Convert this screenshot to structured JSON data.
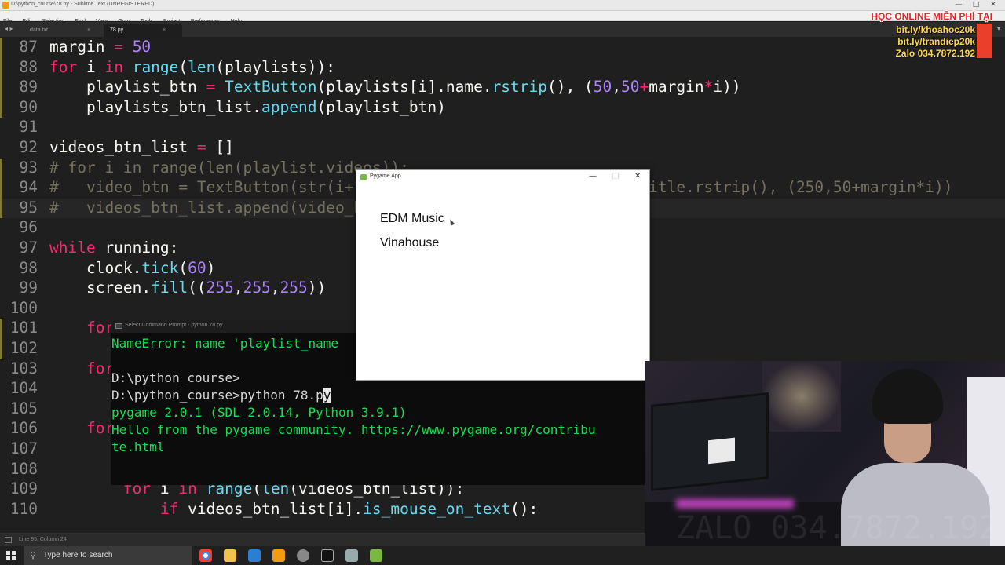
{
  "window": {
    "title": "D:\\python_course\\78.py - Sublime Text (UNREGISTERED)",
    "controls": [
      "—",
      "□",
      "✕"
    ]
  },
  "menu": [
    "File",
    "Edit",
    "Selection",
    "Find",
    "View",
    "Goto",
    "Tools",
    "Project",
    "Preferences",
    "Help"
  ],
  "tabs": [
    {
      "label": "data.txt",
      "close": "×"
    },
    {
      "label": "78.py",
      "close": "×"
    }
  ],
  "tabbar": {
    "nav": "◂ ▸",
    "dropdown": "▾"
  },
  "editor": {
    "lines": [
      {
        "n": "87",
        "tokens": [
          [
            "fg",
            "margin "
          ],
          [
            "op",
            "="
          ],
          [
            "fg",
            " "
          ],
          [
            "num",
            "50"
          ]
        ]
      },
      {
        "n": "88",
        "tokens": [
          [
            "kw",
            "for"
          ],
          [
            "fg",
            " i "
          ],
          [
            "kw",
            "in"
          ],
          [
            "fg",
            " "
          ],
          [
            "fn",
            "range"
          ],
          [
            "fg",
            "("
          ],
          [
            "fn",
            "len"
          ],
          [
            "fg",
            "(playlists)):"
          ]
        ]
      },
      {
        "n": "89",
        "tokens": [
          [
            "fg",
            "    playlist_btn "
          ],
          [
            "op",
            "="
          ],
          [
            "fg",
            " "
          ],
          [
            "fn",
            "TextButton"
          ],
          [
            "fg",
            "(playlists[i].name."
          ],
          [
            "fn",
            "rstrip"
          ],
          [
            "fg",
            "(), ("
          ],
          [
            "num",
            "50"
          ],
          [
            "fg",
            ","
          ],
          [
            "num",
            "50"
          ],
          [
            "op",
            "+"
          ],
          [
            "fg",
            "margin"
          ],
          [
            "op",
            "*"
          ],
          [
            "fg",
            "i))"
          ]
        ]
      },
      {
        "n": "90",
        "tokens": [
          [
            "fg",
            "    playlists_btn_list."
          ],
          [
            "fn",
            "append"
          ],
          [
            "fg",
            "(playlist_btn)"
          ]
        ]
      },
      {
        "n": "91",
        "tokens": []
      },
      {
        "n": "92",
        "tokens": [
          [
            "fg",
            "videos_btn_list "
          ],
          [
            "op",
            "="
          ],
          [
            "fg",
            " []"
          ]
        ]
      },
      {
        "n": "93",
        "tokens": [
          [
            "cm",
            "# for i in range(len(playlist.videos)):"
          ]
        ]
      },
      {
        "n": "94",
        "tokens": [
          [
            "cm",
            "#   video_btn = TextButton(str(i+1) + \". \" + playlist.videos[i].title.rstrip(), (250,50+margin*i))"
          ]
        ]
      },
      {
        "n": "95",
        "tokens": [
          [
            "cm",
            "#   videos_btn_list.append(video_btn)"
          ]
        ]
      },
      {
        "n": "96",
        "tokens": []
      },
      {
        "n": "97",
        "tokens": [
          [
            "kw",
            "while"
          ],
          [
            "fg",
            " running:"
          ]
        ]
      },
      {
        "n": "98",
        "tokens": [
          [
            "fg",
            "    clock."
          ],
          [
            "fn",
            "tick"
          ],
          [
            "fg",
            "("
          ],
          [
            "num",
            "60"
          ],
          [
            "fg",
            ")"
          ]
        ]
      },
      {
        "n": "99",
        "tokens": [
          [
            "fg",
            "    screen."
          ],
          [
            "fn",
            "fill"
          ],
          [
            "fg",
            "(("
          ],
          [
            "num",
            "255"
          ],
          [
            "fg",
            ","
          ],
          [
            "num",
            "255"
          ],
          [
            "fg",
            ","
          ],
          [
            "num",
            "255"
          ],
          [
            "fg",
            "))"
          ]
        ]
      },
      {
        "n": "100",
        "tokens": []
      },
      {
        "n": "101",
        "tokens": [
          [
            "fg",
            "    "
          ],
          [
            "kw",
            "for"
          ]
        ]
      },
      {
        "n": "102",
        "tokens": []
      },
      {
        "n": "103",
        "tokens": [
          [
            "fg",
            "    "
          ],
          [
            "kw",
            "for"
          ]
        ]
      },
      {
        "n": "104",
        "tokens": []
      },
      {
        "n": "105",
        "tokens": []
      },
      {
        "n": "106",
        "tokens": [
          [
            "fg",
            "    "
          ],
          [
            "kw",
            "for"
          ]
        ]
      },
      {
        "n": "107",
        "tokens": []
      },
      {
        "n": "108",
        "tokens": []
      },
      {
        "n": "109",
        "tokens": [
          [
            "fg",
            "        "
          ],
          [
            "kw",
            "for"
          ],
          [
            "fg",
            " i "
          ],
          [
            "kw",
            "in"
          ],
          [
            "fg",
            " "
          ],
          [
            "fn",
            "range"
          ],
          [
            "fg",
            "("
          ],
          [
            "fn",
            "len"
          ],
          [
            "fg",
            "(videos_btn_list)):"
          ]
        ]
      },
      {
        "n": "110",
        "tokens": [
          [
            "fg",
            "            "
          ],
          [
            "kw",
            "if"
          ],
          [
            "fg",
            " videos_btn_list[i]."
          ],
          [
            "fn",
            "is_mouse_on_text"
          ],
          [
            "fg",
            "():"
          ]
        ]
      }
    ]
  },
  "status": {
    "text": "Line 95, Column 24"
  },
  "cmd": {
    "title": "Select Command Prompt - python 78.py",
    "lines": [
      {
        "style": "g",
        "text": "NameError: name 'playlist_name"
      },
      {
        "style": "w",
        "text": ""
      },
      {
        "style": "w",
        "text": "D:\\python_course>"
      },
      {
        "style": "w",
        "text": "D:\\python_course>python 78.p"
      },
      {
        "style": "g",
        "text": "pygame 2.0.1 (SDL 2.0.14, Python 3.9.1)"
      },
      {
        "style": "g",
        "text": "Hello from the pygame community. https://www.pygame.org/contribu"
      },
      {
        "style": "g",
        "text": "te.html"
      }
    ],
    "caret_char": "y"
  },
  "pygame": {
    "title": "Pygame App",
    "controls": [
      "—",
      "□",
      "✕"
    ],
    "buttons": [
      "EDM Music",
      "Vinahouse"
    ]
  },
  "ad": {
    "title": "HỌC ONLINE MIỄN PHÍ TẠI",
    "lines": [
      "bit.ly/khoahoc20k",
      "bit.ly/trandiep20k",
      "Zalo 034.7872.192"
    ]
  },
  "taskbar": {
    "search_placeholder": "Type here to search"
  },
  "webcam": {
    "watermark": "ZALO 034.7872.192"
  },
  "colors": {
    "accent_kw": "#f92672",
    "accent_fn": "#66d9ef",
    "accent_num": "#ae81ff",
    "comment": "#75715e"
  }
}
